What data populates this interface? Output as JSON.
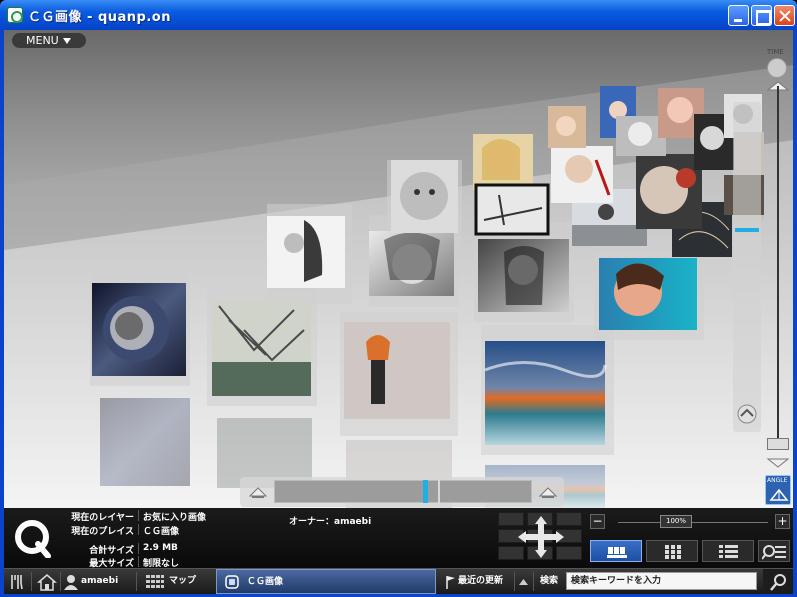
{
  "window": {
    "title": "ＣＧ画像 - quanp.on"
  },
  "viewport": {
    "menu_label": "MENU",
    "time_label": "TIME",
    "angle_label": "ANGLE"
  },
  "info": {
    "rows": [
      {
        "label": "現在のレイヤー",
        "value": "お気に入り画像"
      },
      {
        "label": "現在のプレイス",
        "value": "ＣＧ画像"
      },
      {
        "label": "合計サイズ",
        "value": "2.9 MB"
      },
      {
        "label": "最大サイズ",
        "value": "制限なし"
      }
    ],
    "owner": "オーナー：amaebi",
    "zoom_value": "100%"
  },
  "taskbar": {
    "user": "amaebi",
    "map_label": "マップ",
    "cg_tab_label": "ＣＧ画像",
    "recent_label": "最近の更新",
    "search_label": "検索",
    "search_placeholder": "検索キーワードを入力"
  },
  "colors": {
    "title_bar": "#0a5ae0",
    "accent_cyan": "#22aee0",
    "panel_bg": "#111111",
    "active_tab": "#2b63b0"
  },
  "icons": {
    "app": "app-logo-icon",
    "menu_caret": "caret-down-icon",
    "minimize": "minimize-icon",
    "maximize": "maximize-icon",
    "close": "close-icon",
    "time": "time-rotate-icon",
    "angle": "angle-icon",
    "logo": "quanp-logo-icon",
    "tools": "tools-icon",
    "home": "home-icon",
    "user": "user-icon",
    "map": "grid-map-icon",
    "flag": "flag-icon",
    "search": "magnifier-icon"
  }
}
